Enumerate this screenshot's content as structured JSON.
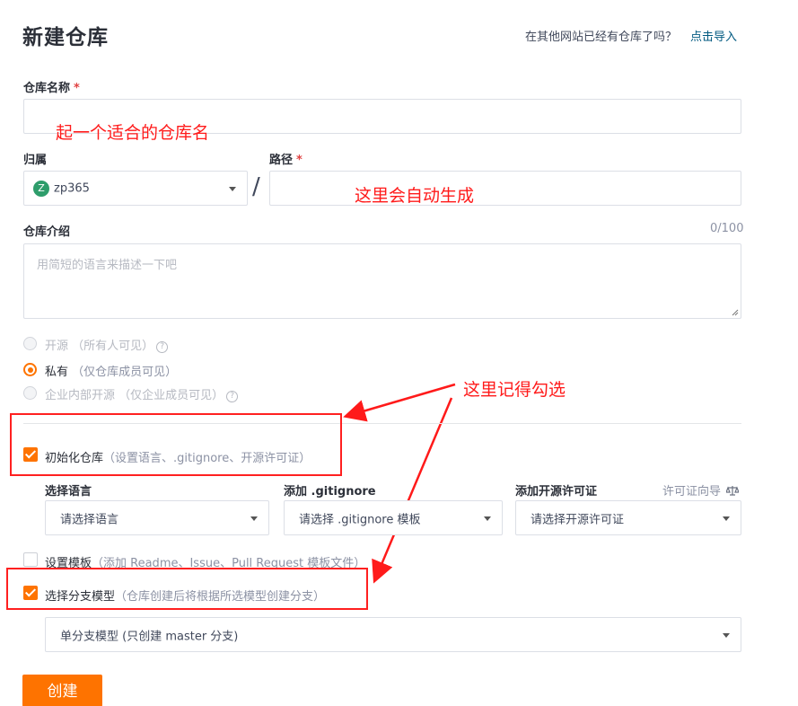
{
  "header": {
    "title": "新建仓库",
    "import_question": "在其他网站已经有仓库了吗？",
    "import_link": "点击导入"
  },
  "repo_name": {
    "label": "仓库名称",
    "required": "*",
    "annotation": "起一个适合的仓库名"
  },
  "owner": {
    "label": "归属",
    "avatar_letter": "Z",
    "value": "zp365"
  },
  "separator": "/",
  "path": {
    "label": "路径",
    "required": "*",
    "annotation": "这里会自动生成"
  },
  "intro": {
    "label": "仓库介绍",
    "counter": "0/100",
    "placeholder": "用简短的语言来描述一下吧"
  },
  "visibility": [
    {
      "label": "开源",
      "hint": "（所有人可见）",
      "help": "?",
      "selected": false,
      "disabled": true
    },
    {
      "label": "私有",
      "hint": "（仅仓库成员可见）",
      "help": "",
      "selected": true,
      "disabled": false
    },
    {
      "label": "企业内部开源",
      "hint": "（仅企业成员可见）",
      "help": "?",
      "selected": false,
      "disabled": true
    }
  ],
  "annotation_check": "这里记得勾选",
  "init_repo": {
    "label": "初始化仓库",
    "hint": "（设置语言、.gitignore、开源许可证）",
    "checked": true
  },
  "init_options": {
    "language": {
      "label": "选择语言",
      "placeholder": "请选择语言"
    },
    "gitignore": {
      "label": "添加 .gitignore",
      "placeholder": "请选择 .gitignore 模板"
    },
    "license": {
      "label": "添加开源许可证",
      "placeholder": "请选择开源许可证",
      "guide": "许可证向导",
      "guide_icon": "scale-icon"
    }
  },
  "template": {
    "label": "设置模板",
    "hint": "（添加 Readme、Issue、Pull Request 模板文件）",
    "checked": false
  },
  "branch_model": {
    "label": "选择分支模型",
    "hint": "（仓库创建后将根据所选模型创建分支）",
    "checked": true,
    "value": "单分支模型 (只创建 master 分支)"
  },
  "submit": {
    "label": "创建"
  },
  "colors": {
    "accent": "#fe7300",
    "link": "#005980",
    "annotation": "#ff1a1a",
    "required": "#e04141"
  }
}
